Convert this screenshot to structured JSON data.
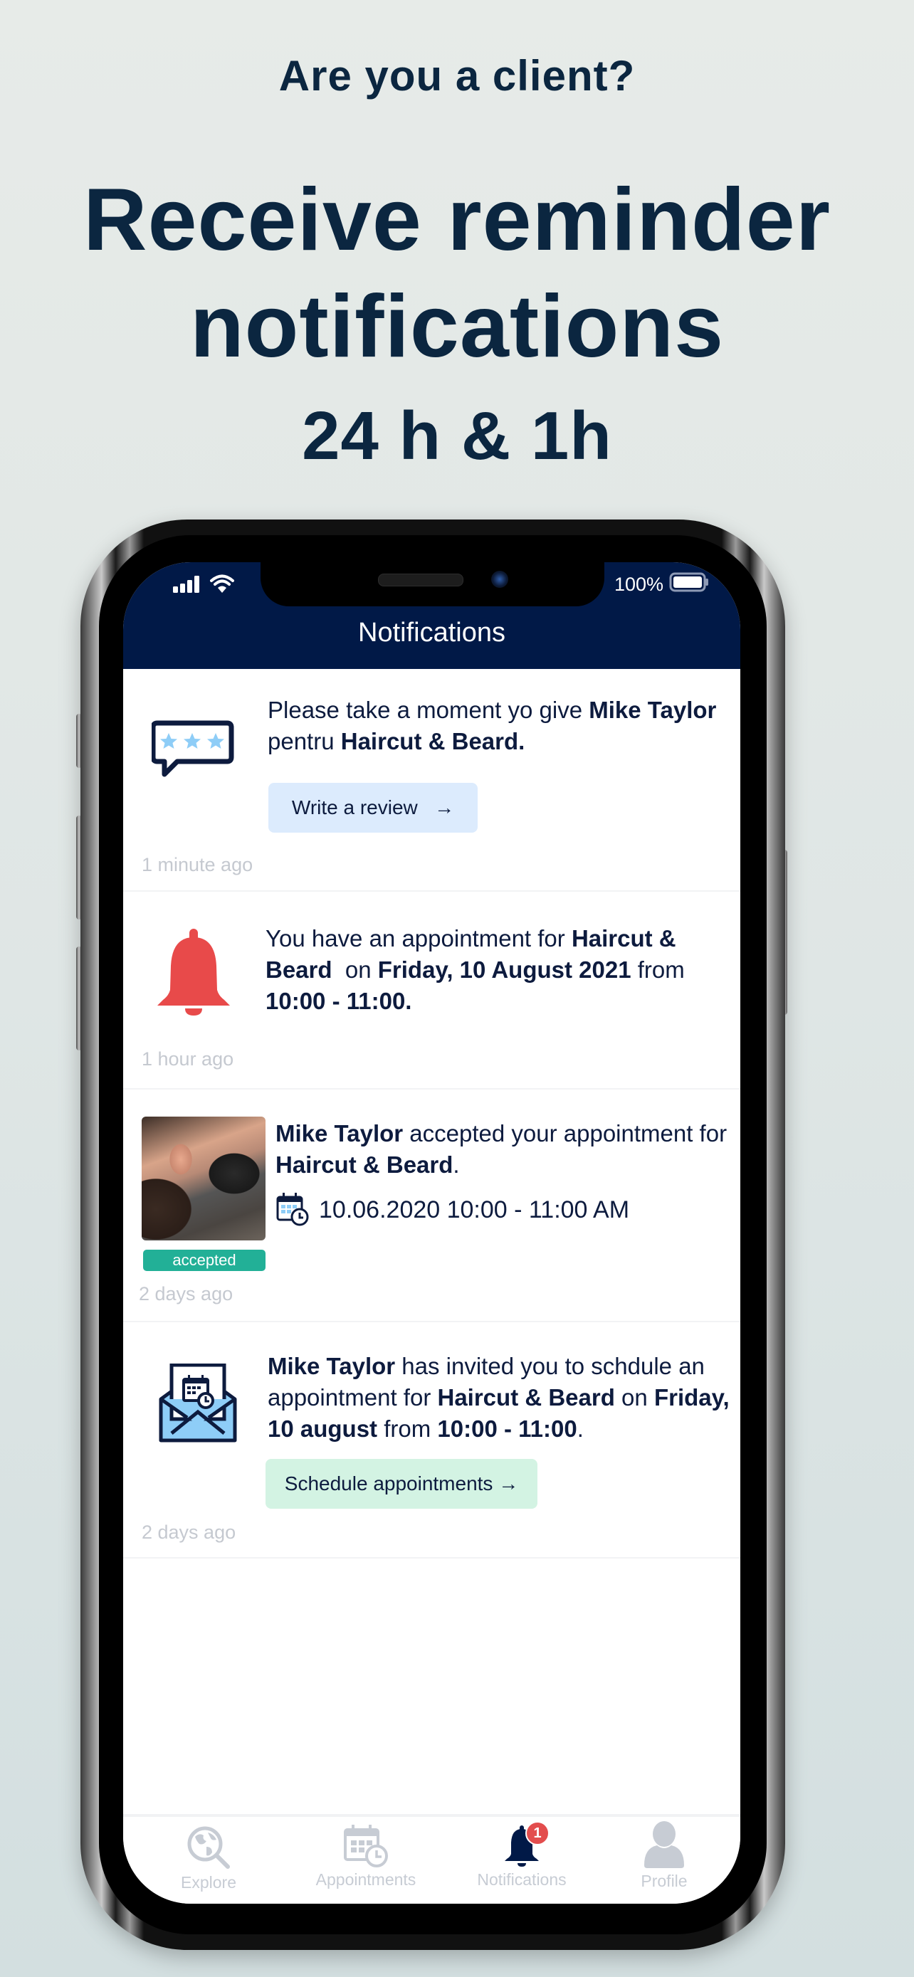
{
  "promo": {
    "question": "Are you a client?",
    "headline_line1": "Receive reminder",
    "headline_line2": "notifications",
    "subheadline": "24 h & 1h"
  },
  "status_bar": {
    "battery_percent": "100%",
    "signal_icon": "cellular-signal-icon",
    "wifi_icon": "wifi-icon",
    "battery_icon": "battery-icon"
  },
  "nav": {
    "title": "Notifications"
  },
  "notifications": [
    {
      "icon": "review-stars-icon",
      "segments": [
        {
          "text": "Please take a moment yo give ",
          "bold": false
        },
        {
          "text": "Mike Taylor",
          "bold": true
        },
        {
          "text": " pentru ",
          "bold": false
        },
        {
          "text": "Haircut & Beard.",
          "bold": true
        }
      ],
      "action_label": "Write a review",
      "action_arrow": "→",
      "time": "1 minute ago"
    },
    {
      "icon": "bell-icon",
      "segments": [
        {
          "text": "You have an appointment for ",
          "bold": false
        },
        {
          "text": "Haircut & Beard",
          "bold": true
        },
        {
          "text": "  on ",
          "bold": false
        },
        {
          "text": "Friday, 10 August 2021",
          "bold": true
        },
        {
          "text": " from ",
          "bold": false
        },
        {
          "text": "10:00 - 11:00.",
          "bold": true
        }
      ],
      "time": "1 hour ago"
    },
    {
      "icon": "barber-photo",
      "status_badge": "accepted",
      "segments": [
        {
          "text": "Mike Taylor",
          "bold": true
        },
        {
          "text": " accepted your appointment for ",
          "bold": false
        },
        {
          "text": "Haircut & Beard",
          "bold": true
        },
        {
          "text": ".",
          "bold": false
        }
      ],
      "datetime": "10.06.2020 10:00 - 11:00 AM",
      "time": "2 days ago"
    },
    {
      "icon": "calendar-invite-icon",
      "segments": [
        {
          "text": "Mike Taylor",
          "bold": true
        },
        {
          "text": " has invited you to schdule an appointment for ",
          "bold": false
        },
        {
          "text": "Haircut & Beard",
          "bold": true
        },
        {
          "text": " on ",
          "bold": false
        },
        {
          "text": "Friday, 10 august",
          "bold": true
        },
        {
          "text": " from ",
          "bold": false
        },
        {
          "text": "10:00 - 11:00",
          "bold": true
        },
        {
          "text": ".",
          "bold": false
        }
      ],
      "action_label": "Schedule appointments",
      "action_arrow": "→",
      "time": "2 days ago"
    }
  ],
  "tabbar": {
    "tabs": [
      {
        "label": "Explore",
        "icon": "globe-search-icon",
        "active": false
      },
      {
        "label": "Appointments",
        "icon": "calendar-clock-icon",
        "active": false
      },
      {
        "label": "Notifications",
        "icon": "bell-icon",
        "active": true,
        "badge": "1"
      },
      {
        "label": "Profile",
        "icon": "user-icon",
        "active": false
      }
    ]
  },
  "colors": {
    "brand_navy": "#011947",
    "text_dark": "#0d1b3e",
    "alert_red": "#e84a4a",
    "accepted_green": "#22b097",
    "review_button_bg": "#dcebfd",
    "schedule_button_bg": "#d3f3e3",
    "icon_light_blue": "#8ecdf7",
    "inactive_gray": "#c7ccd4"
  }
}
